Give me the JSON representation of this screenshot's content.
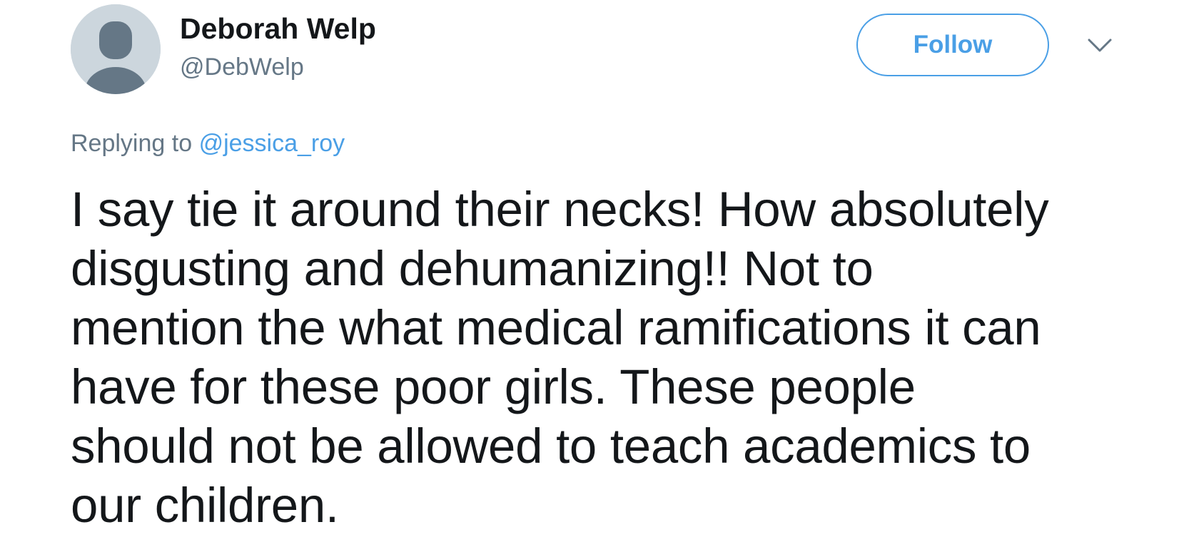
{
  "user": {
    "display_name": "Deborah Welp",
    "handle": "@DebWelp"
  },
  "actions": {
    "follow_label": "Follow",
    "menu_icon": "chevron-down-icon"
  },
  "reply": {
    "prefix": "Replying to",
    "mention": "@jessica_roy"
  },
  "tweet": {
    "lines": [
      "I say tie it around their necks! How absolutely",
      "disgusting and dehumanizing!! Not to",
      "mention the what medical ramifications it can",
      "have for these poor girls. These people",
      "should not be allowed to teach academics to",
      "our children."
    ]
  },
  "colors": {
    "accent": "#4a9fe6",
    "secondary_text": "#657786",
    "primary_text": "#14171a",
    "avatar_bg": "#ccd6dd",
    "avatar_figure": "#657786"
  }
}
